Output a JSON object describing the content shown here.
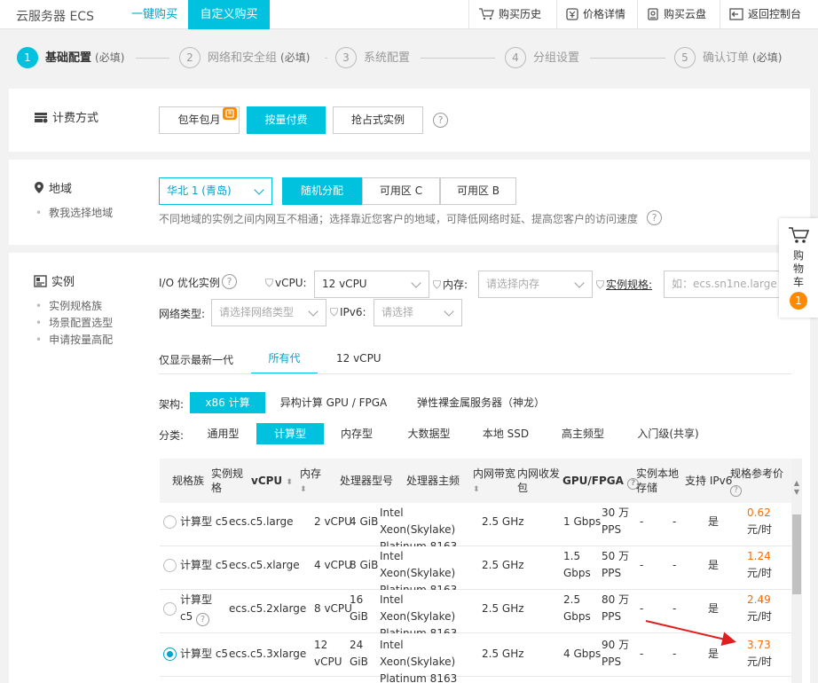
{
  "topbar": {
    "brand": "云服务器 ECS",
    "tab_quick": "一键购买",
    "tab_custom": "自定义购买",
    "links": [
      "购买历史",
      "价格详情",
      "购买云盘",
      "返回控制台"
    ]
  },
  "steps": [
    {
      "num": "1",
      "label": "基础配置",
      "req": "(必填)"
    },
    {
      "num": "2",
      "label": "网络和安全组",
      "req": "(必填)"
    },
    {
      "num": "3",
      "label": "系统配置",
      "req": ""
    },
    {
      "num": "4",
      "label": "分组设置",
      "req": ""
    },
    {
      "num": "5",
      "label": "确认订单",
      "req": "(必填)"
    }
  ],
  "billing": {
    "title": "计费方式",
    "options": [
      "包年包月",
      "按量付费",
      "抢占式实例"
    ],
    "selected": "按量付费",
    "help": "?"
  },
  "region": {
    "title": "地域",
    "side": [
      "教我选择地域"
    ],
    "region_select": "华北 1 (青岛)",
    "zones": [
      "随机分配",
      "可用区 C",
      "可用区 B"
    ],
    "selected_zone": "随机分配",
    "hint": "不同地域的实例之间内网互不相通；选择靠近您客户的地域，可降低网络时延、提高您客户的访问速度",
    "help": "?"
  },
  "instance": {
    "title": "实例",
    "side": [
      "实例规格族",
      "场景配置选型",
      "申请按量高配"
    ],
    "filters": {
      "io_label": "I/O 优化实例",
      "vcpu_label": "vCPU:",
      "vcpu_value": "12 vCPU",
      "mem_label": "内存:",
      "mem_placeholder": "请选择内存",
      "spec_label": "实例规格:",
      "spec_placeholder": "如：ecs.sn1ne.large",
      "net_label": "网络类型:",
      "net_placeholder": "请选择网络类型",
      "ipv6_label": "IPv6:",
      "ipv6_placeholder": "请选择",
      "help": "?"
    },
    "gen_tabs": [
      "仅显示最新一代",
      "所有代",
      "12 vCPU"
    ],
    "gen_selected": "所有代",
    "arch_label": "架构:",
    "arch_options": [
      "x86 计算",
      "异构计算 GPU / FPGA",
      "弹性裸金属服务器（神龙）"
    ],
    "arch_selected": "x86 计算",
    "cat_label": "分类:",
    "cat_options": [
      "通用型",
      "计算型",
      "内存型",
      "大数据型",
      "本地 SSD",
      "高主频型",
      "入门级(共享)"
    ],
    "cat_selected": "计算型"
  },
  "table": {
    "headers": {
      "family": "规格族",
      "spec": "实例规格",
      "vcpu": "vCPU",
      "mem": "内存",
      "cpu_model": "处理器型号",
      "freq": "处理器主频",
      "bandwidth": "内网带宽",
      "pps": "内网收发包",
      "gpu": "GPU/FPGA",
      "local": "实例本地存储",
      "ipv6": "支持 IPv6",
      "price": "规格参考价"
    },
    "rows": [
      {
        "family": "计算型 c5",
        "spec": "ecs.c5.large",
        "vcpu": "2 vCPU",
        "mem": "4 GiB",
        "cpu": "Intel Xeon(Skylake) Platinum 8163",
        "freq": "2.5 GHz",
        "bw": "1 Gbps",
        "pps": "30 万 PPS",
        "gpu": "-",
        "local": "-",
        "ipv6": "是",
        "price": "0.62",
        "unit": "元/时",
        "selected": false
      },
      {
        "family": "计算型 c5",
        "spec": "ecs.c5.xlarge",
        "vcpu": "4 vCPU",
        "mem": "8 GiB",
        "cpu": "Intel Xeon(Skylake) Platinum 8163",
        "freq": "2.5 GHz",
        "bw": "1.5 Gbps",
        "pps": "50 万 PPS",
        "gpu": "-",
        "local": "-",
        "ipv6": "是",
        "price": "1.24",
        "unit": "元/时",
        "selected": false
      },
      {
        "family": "计算型 c5",
        "spec": "ecs.c5.2xlarge",
        "vcpu": "8 vCPU",
        "mem": "16 GiB",
        "cpu": "Intel Xeon(Skylake) Platinum 8163",
        "freq": "2.5 GHz",
        "bw": "2.5 Gbps",
        "pps": "80 万 PPS",
        "gpu": "-",
        "local": "-",
        "ipv6": "是",
        "price": "2.49",
        "unit": "元/时",
        "selected": false
      },
      {
        "family": "计算型 c5",
        "spec": "ecs.c5.3xlarge",
        "vcpu": "12 vCPU",
        "mem": "24 GiB",
        "cpu": "Intel Xeon(Skylake) Platinum 8163",
        "freq": "2.5 GHz",
        "bw": "4 Gbps",
        "pps": "90 万 PPS",
        "gpu": "-",
        "local": "-",
        "ipv6": "是",
        "price": "3.73",
        "unit": "元/时",
        "selected": true
      }
    ]
  },
  "cart": {
    "label": "购物车",
    "count": "1"
  },
  "colors": {
    "accent": "#00c1de",
    "link": "#00a2ca",
    "price": "#ff6a00",
    "annotation": "#e02020"
  }
}
